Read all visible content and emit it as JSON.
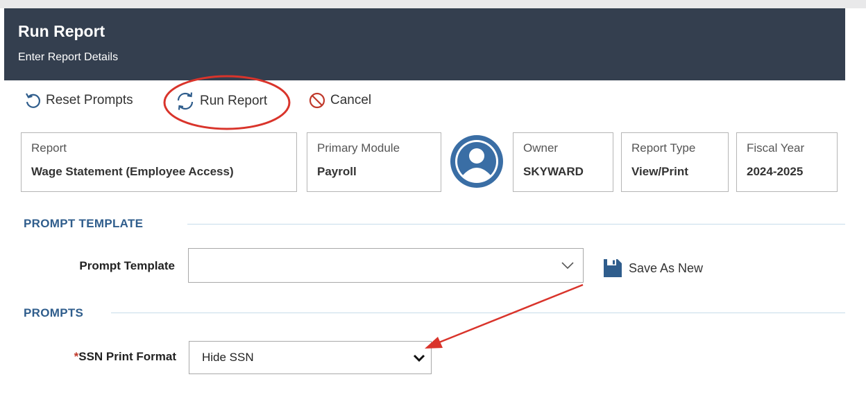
{
  "header": {
    "title": "Run Report",
    "subtitle": "Enter Report Details"
  },
  "toolbar": {
    "reset_label": "Reset Prompts",
    "run_label": "Run Report",
    "cancel_label": "Cancel"
  },
  "report_info": {
    "report": {
      "label": "Report",
      "value": "Wage Statement (Employee Access)"
    },
    "primary_module": {
      "label": "Primary Module",
      "value": "Payroll"
    },
    "owner": {
      "label": "Owner",
      "value": "SKYWARD"
    },
    "report_type": {
      "label": "Report Type",
      "value": "View/Print"
    },
    "fiscal_year": {
      "label": "Fiscal Year",
      "value": "2024-2025"
    }
  },
  "prompt_template_section": {
    "title": "PROMPT TEMPLATE",
    "field_label": "Prompt Template",
    "value": "",
    "save_as_new_label": "Save As New"
  },
  "prompts_section": {
    "title": "PROMPTS",
    "required_marker": "*",
    "ssn_label": "SSN Print Format",
    "ssn_value": "Hide SSN"
  },
  "colors": {
    "header_bg": "#343f4f",
    "section_title": "#2f5d8c",
    "annotation_red": "#d9342b",
    "avatar_blue": "#3a6ea5"
  },
  "icons": [
    "reset-icon",
    "refresh-icon",
    "cancel-icon",
    "user-avatar-icon",
    "chevron-down-icon",
    "save-icon"
  ]
}
